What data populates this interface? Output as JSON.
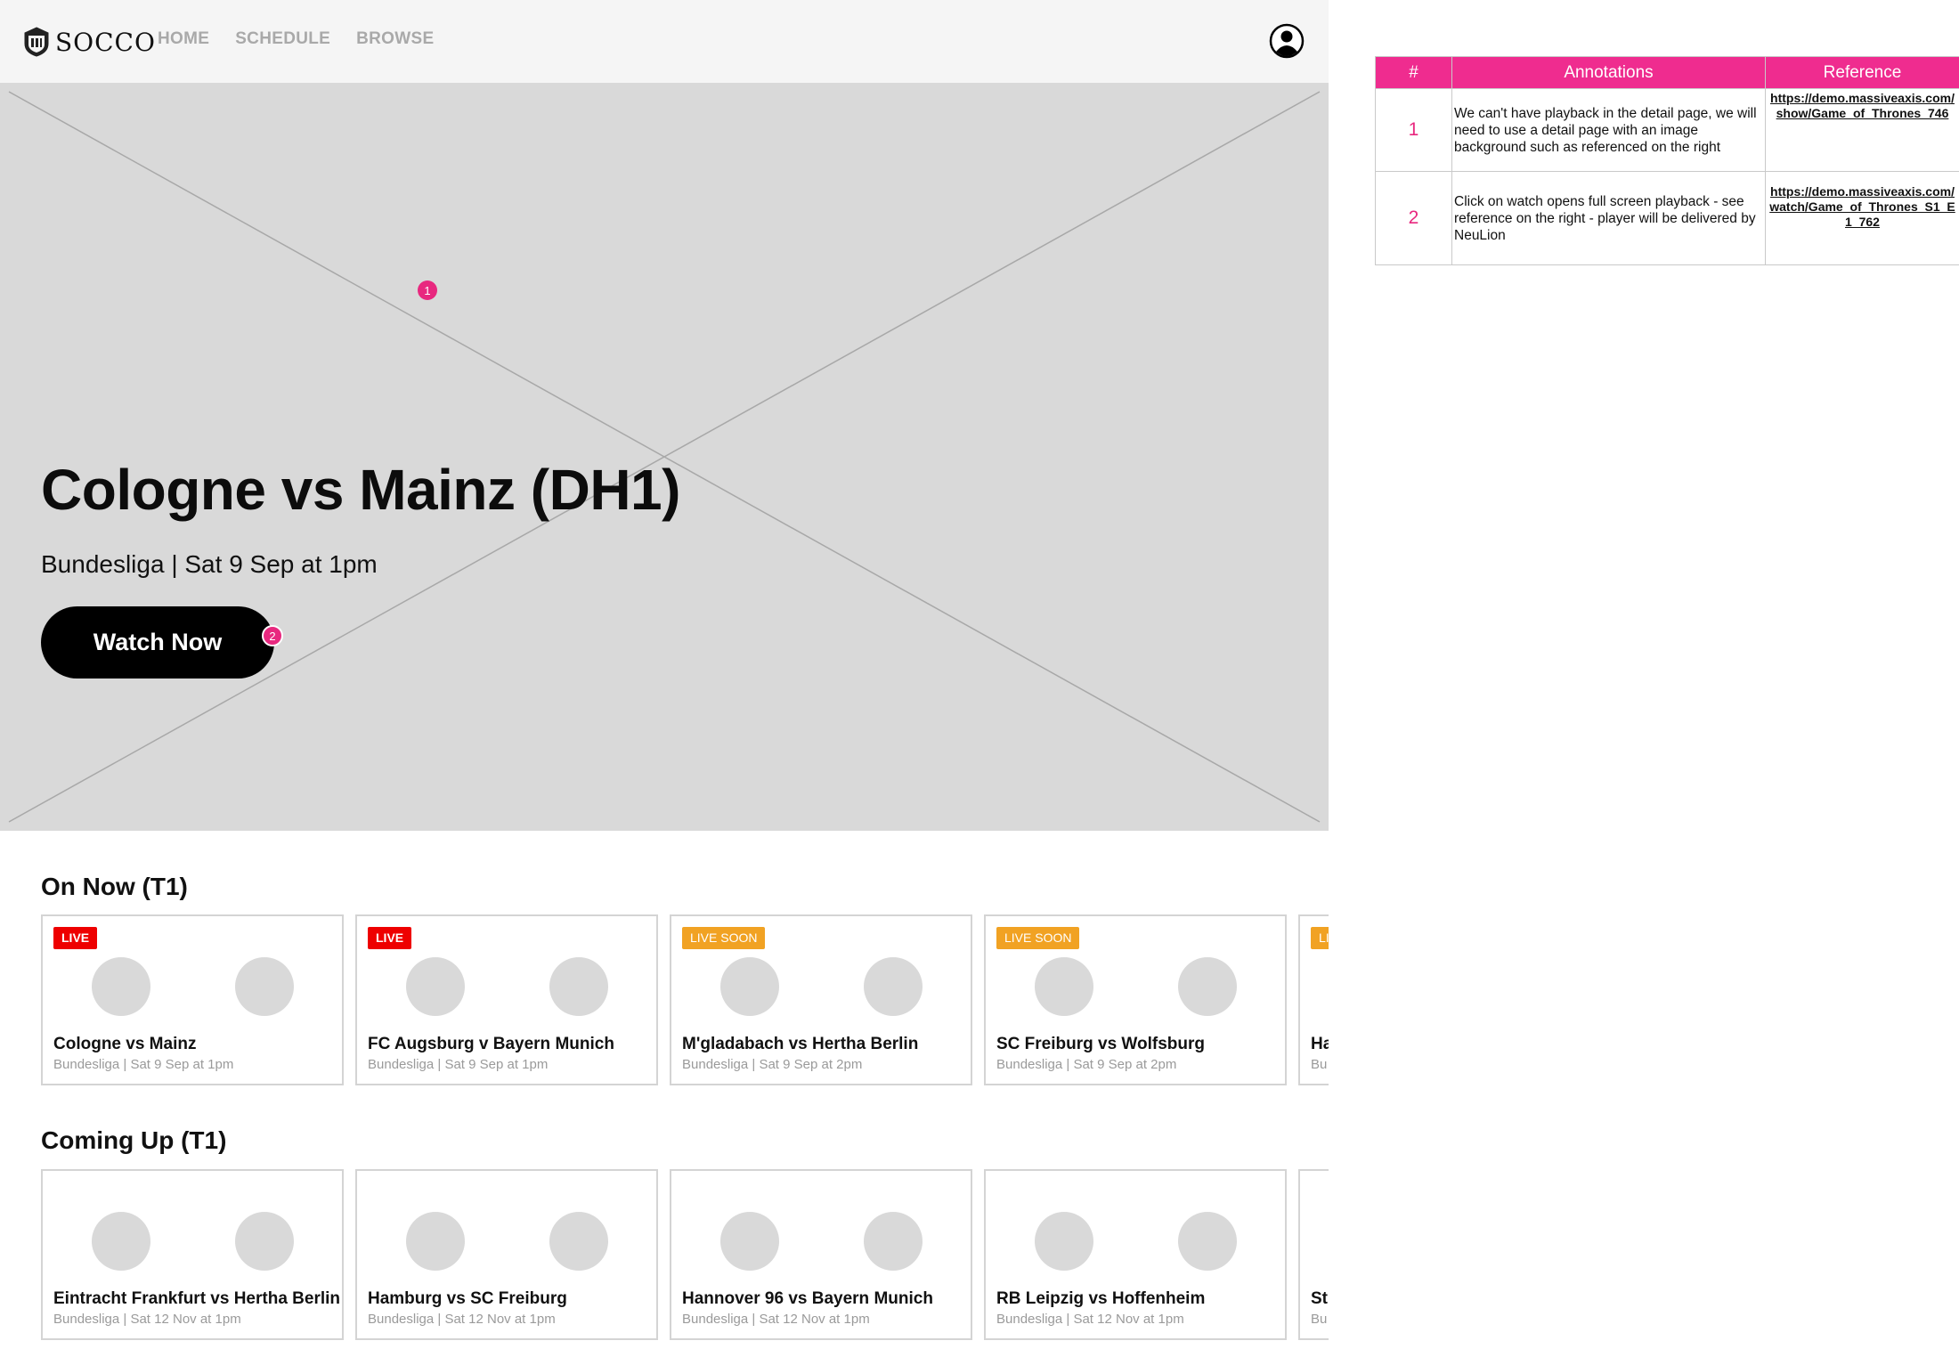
{
  "app": {
    "logo_text": "SOCCO",
    "nav": [
      "HOME",
      "SCHEDULE",
      "BROWSE"
    ]
  },
  "hero": {
    "title": "Cologne vs Mainz (DH1)",
    "subtitle": "Bundesliga | Sat 9 Sep at 1pm",
    "cta_label": "Watch Now",
    "markers": [
      "1",
      "2"
    ]
  },
  "sections": [
    {
      "title": "On Now (T1)",
      "cards": [
        {
          "badge": "LIVE",
          "badge_type": "live",
          "title": "Cologne vs Mainz",
          "subtitle": "Bundesliga | Sat 9 Sep at 1pm"
        },
        {
          "badge": "LIVE",
          "badge_type": "live",
          "title": "FC Augsburg v Bayern Munich",
          "subtitle": "Bundesliga | Sat 9 Sep at 1pm"
        },
        {
          "badge": "LIVE SOON",
          "badge_type": "soon",
          "title": "M'gladabach vs Hertha Berlin",
          "subtitle": "Bundesliga | Sat 9 Sep at 2pm"
        },
        {
          "badge": "LIVE SOON",
          "badge_type": "soon",
          "title": "SC Freiburg vs Wolfsburg",
          "subtitle": "Bundesliga | Sat 9 Sep at 2pm"
        },
        {
          "badge": "LI",
          "badge_type": "soon",
          "title": "Ha",
          "subtitle": "Bu"
        }
      ]
    },
    {
      "title": "Coming Up (T1)",
      "cards": [
        {
          "badge": "",
          "badge_type": "",
          "title": "Eintracht Frankfurt vs Hertha Berlin",
          "subtitle": "Bundesliga | Sat 12 Nov at 1pm"
        },
        {
          "badge": "",
          "badge_type": "",
          "title": "Hamburg vs SC Freiburg",
          "subtitle": "Bundesliga | Sat 12 Nov at 1pm"
        },
        {
          "badge": "",
          "badge_type": "",
          "title": "Hannover 96 vs Bayern Munich",
          "subtitle": "Bundesliga | Sat 12 Nov at 1pm"
        },
        {
          "badge": "",
          "badge_type": "",
          "title": "RB Leipzig vs Hoffenheim",
          "subtitle": "Bundesliga | Sat 12 Nov at 1pm"
        },
        {
          "badge": "",
          "badge_type": "",
          "title": "St",
          "subtitle": "Bu"
        }
      ]
    }
  ],
  "annotations": {
    "headers": [
      "#",
      "Annotations",
      "Reference"
    ],
    "rows": [
      {
        "num": "1",
        "text": "We can't have playback in the detail page, we will need to use a detail page with an image background such as referenced on the right",
        "ref": "https://demo.massiveaxis.com/show/Game_of_Thrones_746"
      },
      {
        "num": "2",
        "text": "Click on watch opens full screen playback - see reference on the right - player will be delivered by NeuLion",
        "ref": "https://demo.massiveaxis.com/watch/Game_of_Thrones_S1_E1_762"
      }
    ]
  },
  "colors": {
    "accent_pink": "#ef2c8f",
    "live_red": "#ee0000",
    "soon_orange": "#f1a223",
    "placeholder_gray": "#d9d9d9"
  }
}
